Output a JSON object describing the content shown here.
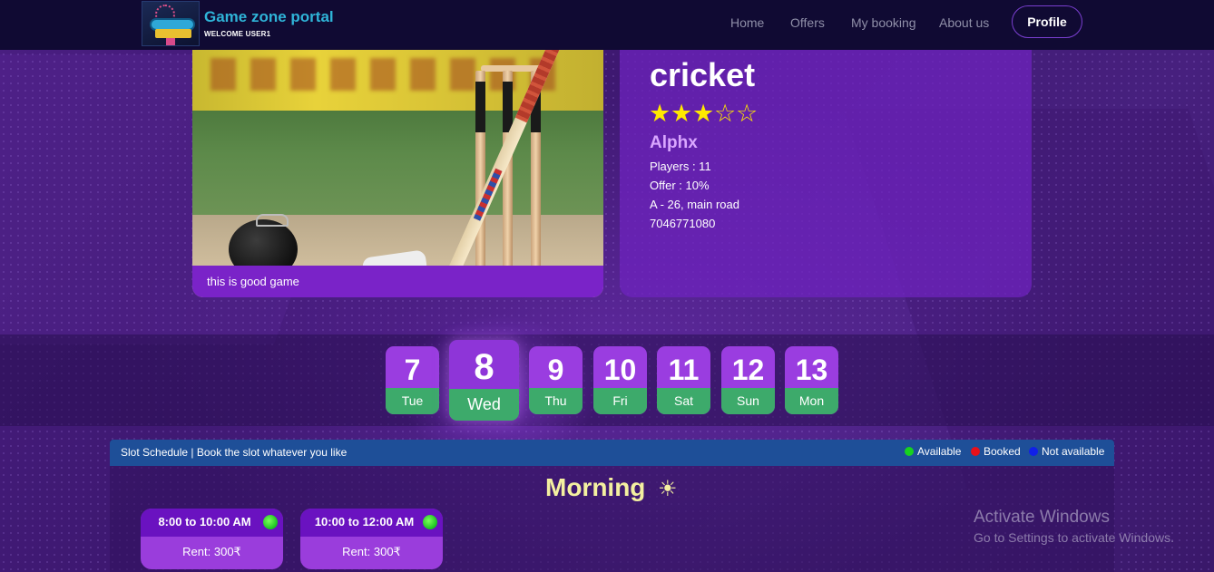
{
  "navbar": {
    "brand_title": "Game zone portal",
    "brand_subtitle": "WELCOME USER1",
    "links": [
      "Home",
      "Offers",
      "My booking",
      "About us"
    ],
    "profile_label": "Profile"
  },
  "game": {
    "caption": "this is good game",
    "title": "cricket",
    "rating": 3,
    "rating_max": 5,
    "owner": "Alphx",
    "players": "Players : 11",
    "offer": "Offer : 10%",
    "address": "A - 26, main road",
    "phone": "7046771080"
  },
  "dates": [
    {
      "num": "7",
      "day": "Tue",
      "selected": false
    },
    {
      "num": "8",
      "day": "Wed",
      "selected": true
    },
    {
      "num": "9",
      "day": "Thu",
      "selected": false
    },
    {
      "num": "10",
      "day": "Fri",
      "selected": false
    },
    {
      "num": "11",
      "day": "Sat",
      "selected": false
    },
    {
      "num": "12",
      "day": "Sun",
      "selected": false
    },
    {
      "num": "13",
      "day": "Mon",
      "selected": false
    }
  ],
  "schedule": {
    "header": "Slot Schedule | Book the slot whatever you like",
    "legend": [
      {
        "label": "Available",
        "color": "#17d21f"
      },
      {
        "label": "Booked",
        "color": "#e8101a"
      },
      {
        "label": "Not available",
        "color": "#1020e8"
      }
    ],
    "section_title": "Morning",
    "slots": [
      {
        "time": "8:00 to 10:00 AM",
        "rent": "Rent: 300₹",
        "status_color": "#17d21f"
      },
      {
        "time": "10:00 to 12:00 AM",
        "rent": "Rent: 300₹",
        "status_color": "#17d21f"
      }
    ]
  },
  "watermark": {
    "title": "Activate Windows",
    "subtitle": "Go to Settings to activate Windows."
  },
  "colors": {
    "navbar_bg": "#100a33",
    "accent": "#7a23c8",
    "day_green": "#3daa6b",
    "star": "#ffe800"
  }
}
